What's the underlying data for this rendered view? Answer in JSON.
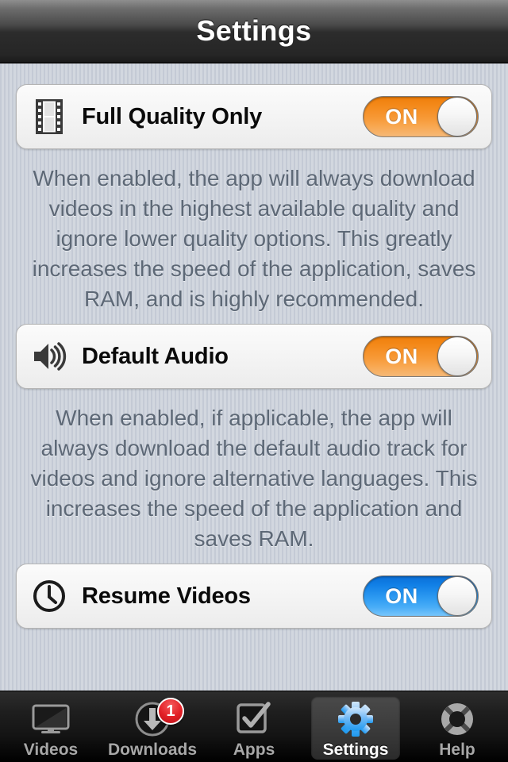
{
  "navbar": {
    "title": "Settings"
  },
  "settings": {
    "rows": [
      {
        "icon": "film-strip-icon",
        "label": "Full Quality Only",
        "switch_state": "ON",
        "switch_color": "#f4891a",
        "description": "When enabled, the app will always download videos in the highest available quality and ignore lower quality options. This greatly increases the speed of the application, saves RAM, and is highly recommended."
      },
      {
        "icon": "speaker-icon",
        "label": "Default Audio",
        "switch_state": "ON",
        "switch_color": "#f4891a",
        "description": "When enabled, if applicable, the app will always download the default audio track for videos and ignore alternative languages. This increases the speed of the application and saves RAM."
      },
      {
        "icon": "clock-icon",
        "label": "Resume Videos",
        "switch_state": "ON",
        "switch_color": "#2e9bf2",
        "description": ""
      }
    ]
  },
  "tabbar": {
    "items": [
      {
        "label": "Videos",
        "icon": "tv-icon",
        "active": false,
        "badge": ""
      },
      {
        "label": "Downloads",
        "icon": "download-icon",
        "active": false,
        "badge": "1"
      },
      {
        "label": "Apps",
        "icon": "checkbox-icon",
        "active": false,
        "badge": ""
      },
      {
        "label": "Settings",
        "icon": "gear-icon",
        "active": true,
        "badge": ""
      },
      {
        "label": "Help",
        "icon": "life-ring-icon",
        "active": false,
        "badge": ""
      }
    ]
  },
  "colors": {
    "orange_accent": "#f4891a",
    "blue_accent": "#2e9bf2",
    "badge_red": "#e21f26",
    "background": "#ccd2da",
    "description_text": "#5d6876"
  }
}
